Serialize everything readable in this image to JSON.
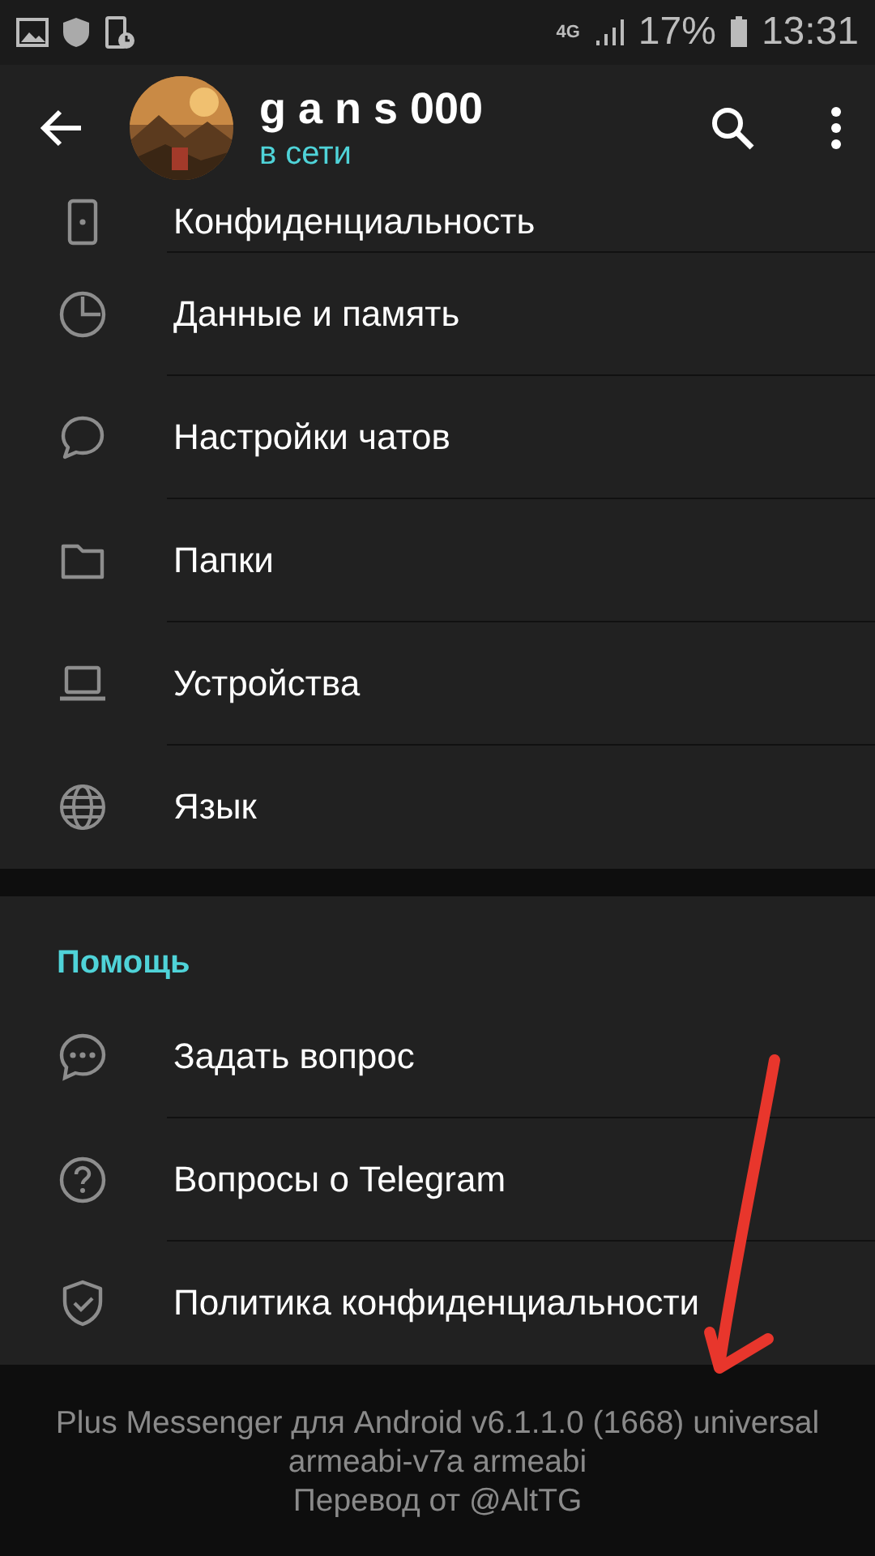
{
  "status_bar": {
    "network": "4G",
    "battery": "17%",
    "time": "13:31"
  },
  "header": {
    "title": "g a n s 000",
    "status": "в сети"
  },
  "sections": [
    {
      "items": [
        {
          "kind": "privacy",
          "label": "Конфиденциальность"
        },
        {
          "kind": "data",
          "label": "Данные и память"
        },
        {
          "kind": "chats",
          "label": "Настройки чатов"
        },
        {
          "kind": "folders",
          "label": "Папки"
        },
        {
          "kind": "devices",
          "label": "Устройства"
        },
        {
          "kind": "language",
          "label": "Язык"
        }
      ]
    },
    {
      "title": "Помощь",
      "items": [
        {
          "kind": "ask",
          "label": "Задать вопрос"
        },
        {
          "kind": "faq",
          "label": "Вопросы о Telegram"
        },
        {
          "kind": "policy",
          "label": "Политика конфиденциальности"
        }
      ]
    }
  ],
  "footer": {
    "lines": [
      "Plus Messenger для Android v6.1.1.0 (1668) universal",
      "armeabi-v7a armeabi",
      "Перевод от @AltTG"
    ]
  },
  "annotation": {
    "kind": "arrow"
  }
}
